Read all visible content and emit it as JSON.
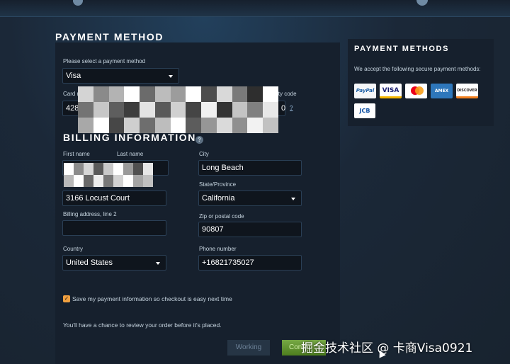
{
  "payment": {
    "heading": "PAYMENT METHOD",
    "select_label": "Please select a payment method",
    "method_value": "Visa",
    "card_label": "Card n",
    "card_value": "428",
    "security_code_label": "ity code",
    "security_value": "0",
    "help_link": "?"
  },
  "billing": {
    "heading": "BILLING INFORMATION",
    "help_icon": "?",
    "first_name_label": "First name",
    "last_name_label": "Last name",
    "city_label": "City",
    "city_value": "Long Beach",
    "address1_value": "3166  Locust Court",
    "state_label": "State/Province",
    "state_value": "California",
    "address2_label": "Billing address, line 2",
    "address2_value": "",
    "zip_label": "Zip or postal code",
    "zip_value": "90807",
    "country_label": "Country",
    "country_value": "United States",
    "phone_label": "Phone number",
    "phone_value": "+16821735027",
    "save_label": "Save my payment information so checkout is easy next time",
    "review_note": "You'll have a chance to review your order before it's placed."
  },
  "buttons": {
    "working_label": "Working",
    "continue_label": "Conti"
  },
  "sidebar": {
    "heading": "PAYMENT METHODS",
    "description": "We accept the following secure payment methods:",
    "cards": [
      {
        "name": "PayPal",
        "label": "PayPal"
      },
      {
        "name": "VISA",
        "label": "VISA"
      },
      {
        "name": "Mastercard",
        "label": ""
      },
      {
        "name": "American Express",
        "label": "AMEX"
      },
      {
        "name": "Discover",
        "label": "DISCOVER"
      },
      {
        "name": "JCB",
        "label": "JCB"
      }
    ]
  },
  "overlay": {
    "watermark": "掘金技术社区 @ 卡商Visa0921"
  },
  "colors": {
    "page_bg": "#1b2838",
    "panel_bg": "#16202d",
    "field_bg": "#0f151d",
    "accent_checkbox": "#f0a040",
    "continue_green": "#5c8a2a"
  },
  "icons": [
    "chevron-down-icon",
    "help-icon",
    "checkmark-icon",
    "mouse-cursor-icon"
  ]
}
